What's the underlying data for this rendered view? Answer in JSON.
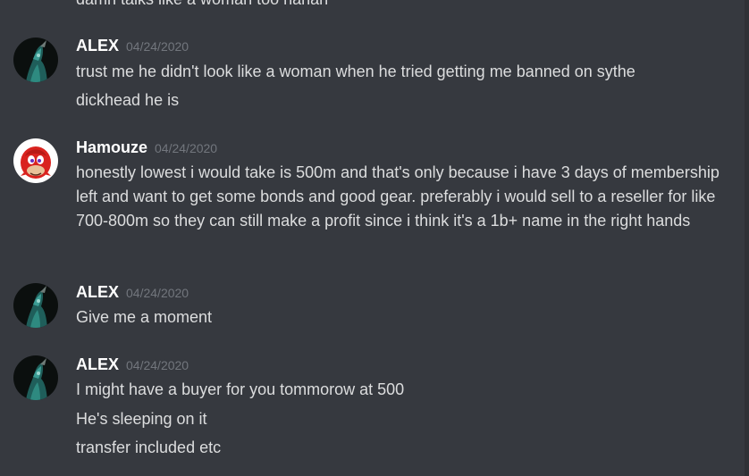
{
  "chat": {
    "top_partial": "damn talks like a woman too hahah",
    "messages": [
      {
        "username": "ALEX",
        "timestamp": "04/24/2020",
        "avatar_icon": "dark-character-avatar",
        "lines": [
          "trust me he didn't look like a woman when he tried getting me banned on sythe",
          "dickhead he is"
        ]
      },
      {
        "username": "Hamouze",
        "timestamp": "04/24/2020",
        "avatar_icon": "red-knuckles-avatar",
        "lines": [
          "honestly lowest i would take is 500m and that's only because i have 3 days of membership left and want to get some bonds and good gear. preferably i would sell to a reseller for like 700-800m so they can still make a profit since i think it's a 1b+ name in the right hands"
        ]
      },
      {
        "username": "ALEX",
        "timestamp": "04/24/2020",
        "avatar_icon": "dark-character-avatar",
        "lines": [
          "Give me a moment"
        ]
      },
      {
        "username": "ALEX",
        "timestamp": "04/24/2020",
        "avatar_icon": "dark-character-avatar",
        "lines": [
          "I might have a buyer for you tommorow at 500",
          "He's sleeping on it",
          "transfer included etc"
        ]
      }
    ]
  },
  "colors": {
    "background": "#36393f",
    "text": "#dcddde",
    "username": "#ffffff",
    "timestamp": "#72767d"
  }
}
